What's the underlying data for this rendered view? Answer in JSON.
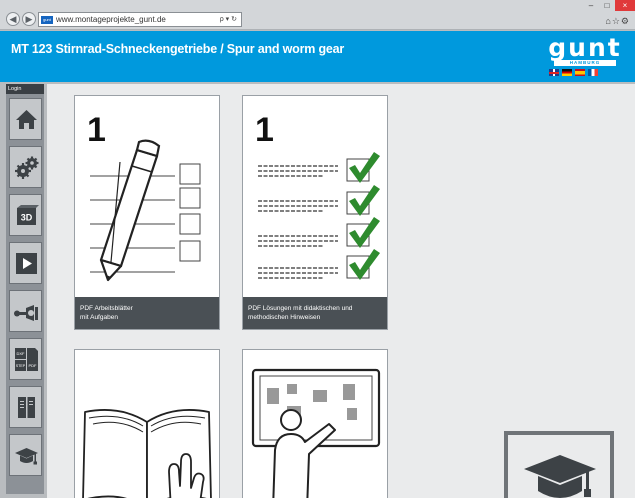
{
  "browser": {
    "nav_back": "◀",
    "nav_forward": "▶",
    "favicon_text": "gunt",
    "url": "www.montageprojekte_gunt.de",
    "address_tools": "ρ ▾ ↻",
    "minimize": "–",
    "maximize": "□",
    "close": "×",
    "toolbar_icons": "⌂☆⚙"
  },
  "header": {
    "title": "MT 123 Stirnrad-Schneckengetriebe / Spur and worm gear",
    "logo_text": "gunt",
    "logo_sub": "HAMBURG",
    "flags": [
      "uk",
      "de",
      "es",
      "fr"
    ]
  },
  "sidebar": {
    "label": "Login",
    "items": [
      {
        "name": "home",
        "icon": "home-icon"
      },
      {
        "name": "gears",
        "icon": "gears-icon"
      },
      {
        "name": "3d",
        "icon": "3d-icon",
        "text": "3D"
      },
      {
        "name": "video",
        "icon": "play-icon"
      },
      {
        "name": "assembly",
        "icon": "wrench-nut-icon"
      },
      {
        "name": "formats",
        "icon": "file-formats-icon",
        "texts": [
          "DXF",
          "STEP",
          "PDF"
        ]
      },
      {
        "name": "documents",
        "icon": "document-icon"
      },
      {
        "name": "teacher",
        "icon": "graduation-cap-icon"
      }
    ]
  },
  "cards": [
    {
      "number": "1",
      "caption_line1": "PDF Arbeitsblätter",
      "caption_line2": "mit Aufgaben"
    },
    {
      "number": "1",
      "caption_line1": "PDF Lösungen mit didaktischen und",
      "caption_line2": "methodischen Hinweisen"
    },
    {
      "name": "manual"
    },
    {
      "name": "presentation"
    }
  ],
  "colors": {
    "header_blue": "#0099dd",
    "check_green": "#2e8b2e",
    "caption_bg": "#4a5055",
    "sidebar_bg": "#8c9197"
  }
}
